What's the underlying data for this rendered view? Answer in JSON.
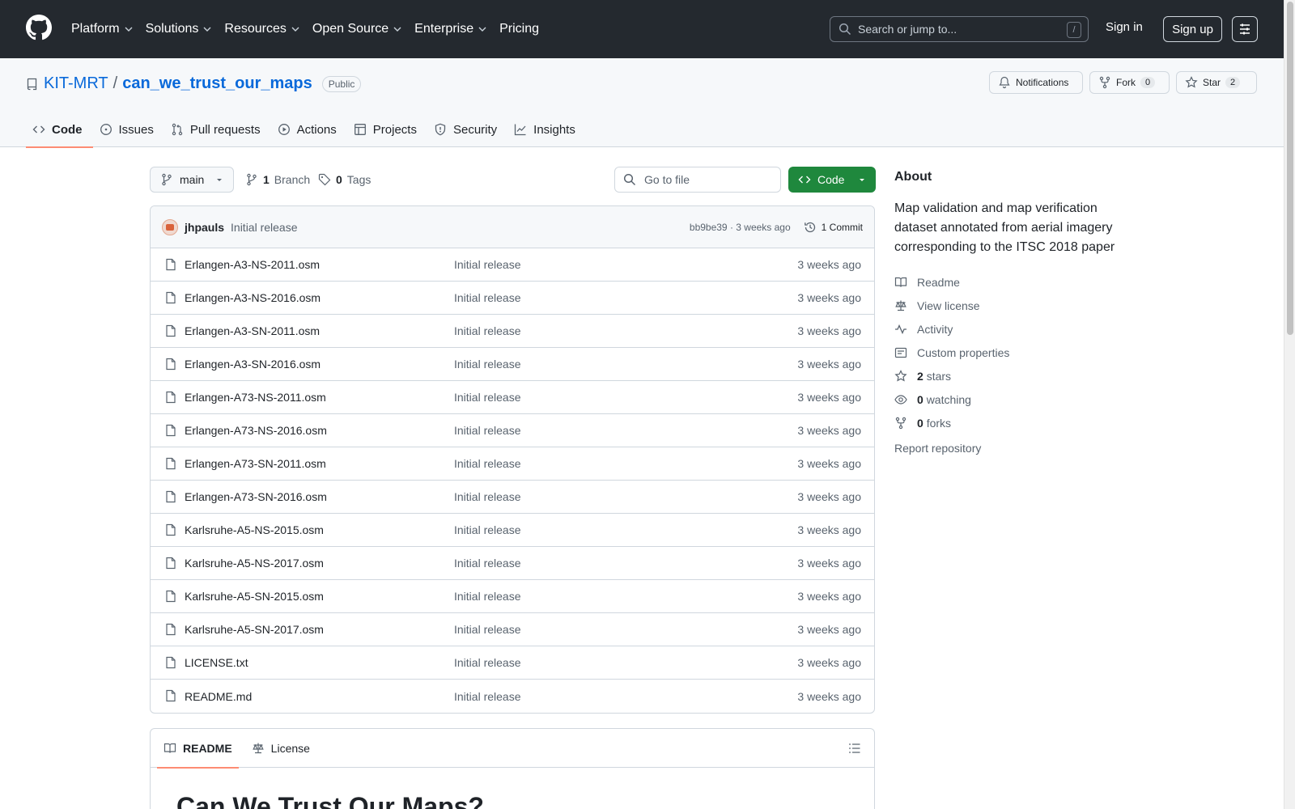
{
  "header": {
    "nav": [
      {
        "label": "Platform",
        "has_menu": true
      },
      {
        "label": "Solutions",
        "has_menu": true
      },
      {
        "label": "Resources",
        "has_menu": true
      },
      {
        "label": "Open Source",
        "has_menu": true
      },
      {
        "label": "Enterprise",
        "has_menu": true
      },
      {
        "label": "Pricing",
        "has_menu": false
      }
    ],
    "search_placeholder": "Search or jump to...",
    "search_shortcut": "/",
    "sign_in": "Sign in",
    "sign_up": "Sign up"
  },
  "repo": {
    "owner": "KIT-MRT",
    "separator": "/",
    "name": "can_we_trust_our_maps",
    "visibility": "Public",
    "notifications_label": "Notifications",
    "fork_label": "Fork",
    "fork_count": "0",
    "star_label": "Star",
    "star_count": "2",
    "tabs": [
      {
        "label": "Code",
        "icon": "code-icon",
        "active": true
      },
      {
        "label": "Issues",
        "icon": "issue-icon",
        "active": false
      },
      {
        "label": "Pull requests",
        "icon": "pull-request-icon",
        "active": false
      },
      {
        "label": "Actions",
        "icon": "play-icon",
        "active": false
      },
      {
        "label": "Projects",
        "icon": "table-icon",
        "active": false
      },
      {
        "label": "Security",
        "icon": "shield-icon",
        "active": false
      },
      {
        "label": "Insights",
        "icon": "graph-icon",
        "active": false
      }
    ]
  },
  "toolbar": {
    "branch": "main",
    "branch_count": "1",
    "branch_label": "Branch",
    "tag_count": "0",
    "tag_label": "Tags",
    "goto_placeholder": "Go to file",
    "code_button": "Code"
  },
  "commit": {
    "author": "jhpauls",
    "message": "Initial release",
    "hash_time": "bb9be39 · 3 weeks ago",
    "commit_count": "1 Commit"
  },
  "files": [
    {
      "name": "Erlangen-A3-NS-2011.osm",
      "message": "Initial release",
      "time": "3 weeks ago"
    },
    {
      "name": "Erlangen-A3-NS-2016.osm",
      "message": "Initial release",
      "time": "3 weeks ago"
    },
    {
      "name": "Erlangen-A3-SN-2011.osm",
      "message": "Initial release",
      "time": "3 weeks ago"
    },
    {
      "name": "Erlangen-A3-SN-2016.osm",
      "message": "Initial release",
      "time": "3 weeks ago"
    },
    {
      "name": "Erlangen-A73-NS-2011.osm",
      "message": "Initial release",
      "time": "3 weeks ago"
    },
    {
      "name": "Erlangen-A73-NS-2016.osm",
      "message": "Initial release",
      "time": "3 weeks ago"
    },
    {
      "name": "Erlangen-A73-SN-2011.osm",
      "message": "Initial release",
      "time": "3 weeks ago"
    },
    {
      "name": "Erlangen-A73-SN-2016.osm",
      "message": "Initial release",
      "time": "3 weeks ago"
    },
    {
      "name": "Karlsruhe-A5-NS-2015.osm",
      "message": "Initial release",
      "time": "3 weeks ago"
    },
    {
      "name": "Karlsruhe-A5-NS-2017.osm",
      "message": "Initial release",
      "time": "3 weeks ago"
    },
    {
      "name": "Karlsruhe-A5-SN-2015.osm",
      "message": "Initial release",
      "time": "3 weeks ago"
    },
    {
      "name": "Karlsruhe-A5-SN-2017.osm",
      "message": "Initial release",
      "time": "3 weeks ago"
    },
    {
      "name": "LICENSE.txt",
      "message": "Initial release",
      "time": "3 weeks ago"
    },
    {
      "name": "README.md",
      "message": "Initial release",
      "time": "3 weeks ago"
    }
  ],
  "readme": {
    "tab_readme": "README",
    "tab_license": "License",
    "heading": "Can We Trust Our Maps?"
  },
  "about": {
    "title": "About",
    "description": "Map validation and map verification dataset annotated from aerial imagery corresponding to the ITSC 2018 paper",
    "links": [
      {
        "icon": "book-icon",
        "count": "",
        "label": "Readme"
      },
      {
        "icon": "law-icon",
        "count": "",
        "label": "View license"
      },
      {
        "icon": "pulse-icon",
        "count": "",
        "label": "Activity"
      },
      {
        "icon": "note-icon",
        "count": "",
        "label": "Custom properties"
      },
      {
        "icon": "star-icon",
        "count": "2",
        "label": "stars"
      },
      {
        "icon": "eye-icon",
        "count": "0",
        "label": "watching"
      },
      {
        "icon": "fork-icon",
        "count": "0",
        "label": "forks"
      }
    ],
    "report": "Report repository"
  },
  "colors": {
    "header_bg": "#24292f",
    "link": "#0969da",
    "primary_button": "#1f883d",
    "active_tab_underline": "#fd8c73"
  }
}
